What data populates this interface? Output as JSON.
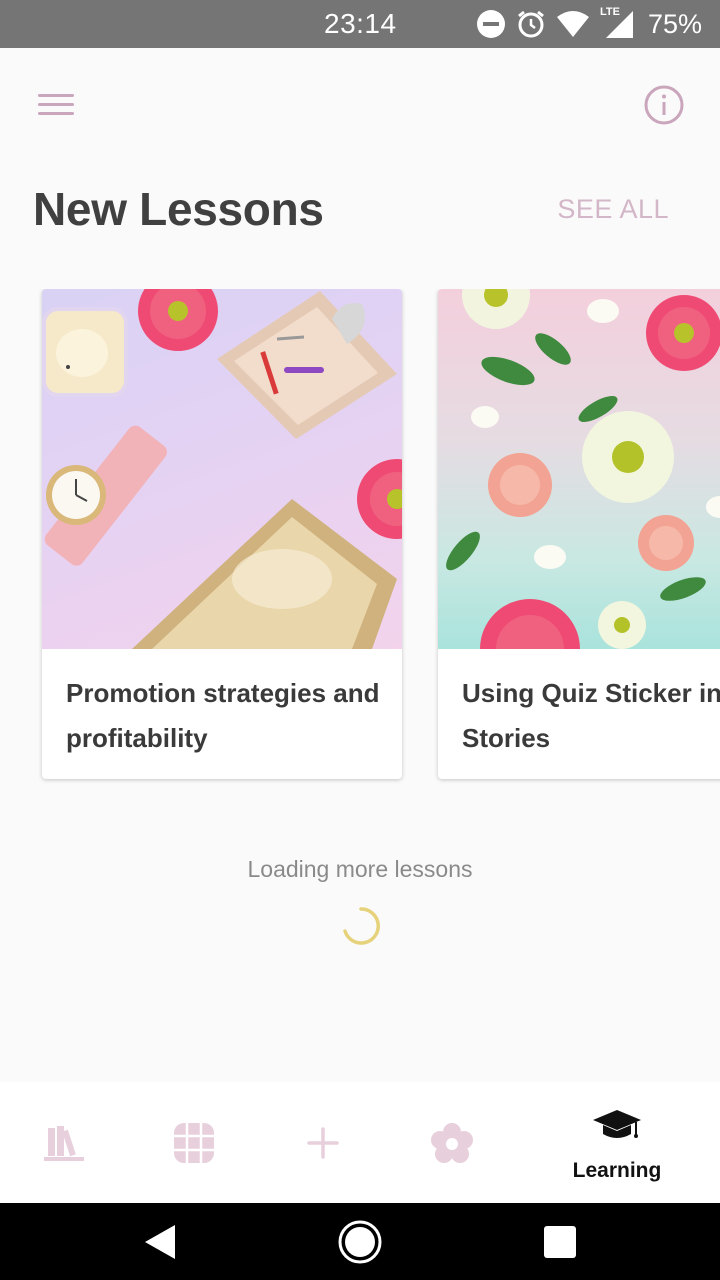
{
  "status_bar": {
    "time": "23:14",
    "battery": "75%",
    "network": "LTE",
    "icons": [
      "dnd-icon",
      "alarm-icon",
      "wifi-icon",
      "lte-signal-icon"
    ]
  },
  "header": {
    "menu_icon": "hamburger-menu-icon",
    "info_icon": "info-icon"
  },
  "section": {
    "title": "New Lessons",
    "see_all": "SEE ALL"
  },
  "lessons": [
    {
      "title": "Promotion strategies and profitability"
    },
    {
      "title": "Using Quiz Sticker in Stories"
    }
  ],
  "loading": {
    "text": "Loading more lessons"
  },
  "bottom_nav": {
    "items": [
      {
        "icon": "library-icon",
        "label": ""
      },
      {
        "icon": "grid-icon",
        "label": ""
      },
      {
        "icon": "plus-icon",
        "label": ""
      },
      {
        "icon": "flower-icon",
        "label": ""
      },
      {
        "icon": "graduation-cap-icon",
        "label": "Learning"
      }
    ]
  },
  "colors": {
    "accent": "#d3b7c8",
    "inactive_icon": "#e8cfdc",
    "title": "#404040",
    "spinner": "#e6d27a",
    "status_bar": "#757575"
  }
}
